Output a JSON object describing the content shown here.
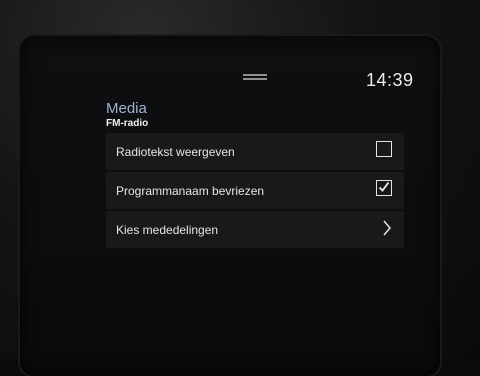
{
  "status_bar": {
    "time": "14:39"
  },
  "page": {
    "title": "Media",
    "subtitle": "FM-radio"
  },
  "settings": {
    "items": [
      {
        "label": "Radiotekst weergeven",
        "control": "checkbox",
        "checked": false
      },
      {
        "label": "Programmanaam bevriezen",
        "control": "checkbox",
        "checked": true
      },
      {
        "label": "Kies mededelingen",
        "control": "chevron-right-icon"
      }
    ]
  },
  "colors": {
    "title_accent": "#9fb2d6",
    "row_background": "#18191a",
    "text": "#e6e6e6"
  }
}
